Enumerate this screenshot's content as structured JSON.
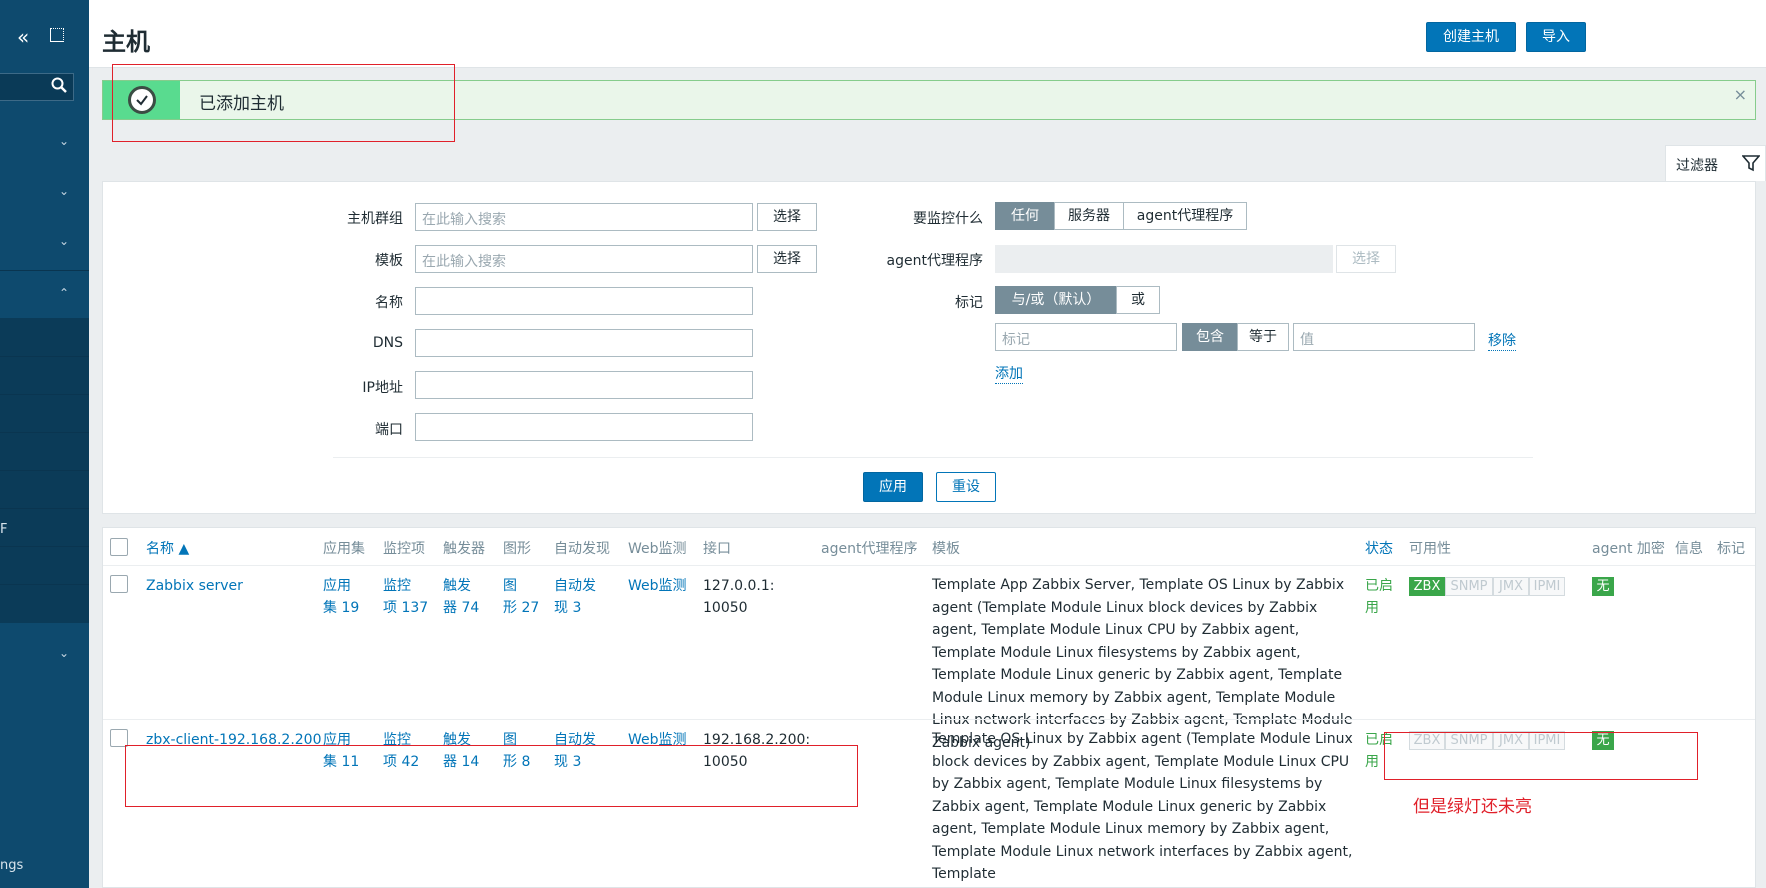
{
  "sidebar": {
    "collapse_icon": "double-chevron-left-icon",
    "popout_icon": "popout-icon",
    "search_icon": "search-icon",
    "bottom_text": "ngs",
    "mid_text": "F"
  },
  "header": {
    "title": "主机",
    "create_host": "创建主机",
    "import": "导入"
  },
  "message": {
    "text": "已添加主机",
    "close": "×"
  },
  "filter": {
    "tab_label": "过滤器",
    "host_group_label": "主机群组",
    "host_group_placeholder": "在此输入搜索",
    "template_label": "模板",
    "template_placeholder": "在此输入搜索",
    "select": "选择",
    "name_label": "名称",
    "dns_label": "DNS",
    "ip_label": "IP地址",
    "port_label": "端口",
    "monitored_by_label": "要监控什么",
    "monitored_by_options": [
      "任何",
      "服务器",
      "agent代理程序"
    ],
    "proxy_label": "agent代理程序",
    "proxy_select": "选择",
    "tags_label": "标记",
    "tags_eval_options": [
      "与/或（默认）",
      "或"
    ],
    "tag_placeholder": "标记",
    "tag_op_options": [
      "包含",
      "等于"
    ],
    "value_placeholder": "值",
    "remove": "移除",
    "add": "添加",
    "apply": "应用",
    "reset": "重设"
  },
  "table": {
    "columns": [
      "名称 ▲",
      "应用集",
      "监控项",
      "触发器",
      "图形",
      "自动发现",
      "Web监测",
      "接口",
      "agent代理程序",
      "模板",
      "状态",
      "可用性",
      "agent 加密",
      "信息",
      "标记"
    ],
    "rows": [
      {
        "name": "Zabbix server",
        "apps": [
          "应用",
          "集 19"
        ],
        "items": [
          "监控",
          "项 137"
        ],
        "triggers": [
          "触发",
          "器 74"
        ],
        "graphs": [
          "图",
          "形 27"
        ],
        "discovery": [
          "自动发",
          "现 3"
        ],
        "web": "Web监测",
        "interface": [
          "127.0.0.1:",
          "10050"
        ],
        "templates": "Template App Zabbix Server, Template OS Linux by Zabbix agent (Template Module Linux block devices by Zabbix agent, Template Module Linux CPU by Zabbix agent, Template Module Linux filesystems by Zabbix agent, Template Module Linux generic by Zabbix agent, Template Module Linux memory by Zabbix agent, Template Module Linux network interfaces by Zabbix agent, Template Module Zabbix agent)",
        "status": [
          "已启",
          "用"
        ],
        "availability": [
          "ZBX",
          "SNMP",
          "JMX",
          "IPMI"
        ],
        "zbx_on": true,
        "encryption": "无"
      },
      {
        "name": "zbx-client-192.168.2.200",
        "apps": [
          "应用",
          "集 11"
        ],
        "items": [
          "监控",
          "项 42"
        ],
        "triggers": [
          "触发",
          "器 14"
        ],
        "graphs": [
          "图",
          "形 8"
        ],
        "discovery": [
          "自动发",
          "现 3"
        ],
        "web": "Web监测",
        "interface": [
          "192.168.2.200:",
          "10050"
        ],
        "templates": "Template OS Linux by Zabbix agent (Template Module Linux block devices by Zabbix agent, Template Module Linux CPU by Zabbix agent, Template Module Linux filesystems by Zabbix agent, Template Module Linux generic by Zabbix agent, Template Module Linux memory by Zabbix agent, Template Module Linux network interfaces by Zabbix agent, Template",
        "status": [
          "已启",
          "用"
        ],
        "availability": [
          "ZBX",
          "SNMP",
          "JMX",
          "IPMI"
        ],
        "zbx_on": false,
        "encryption": "无"
      }
    ]
  },
  "annotation": {
    "text": "但是绿灯还未亮"
  },
  "colors": {
    "sidebar": "#0e4a6e",
    "accent": "#0275b8",
    "success": "#3aa64a",
    "annotation": "#e0202a"
  }
}
